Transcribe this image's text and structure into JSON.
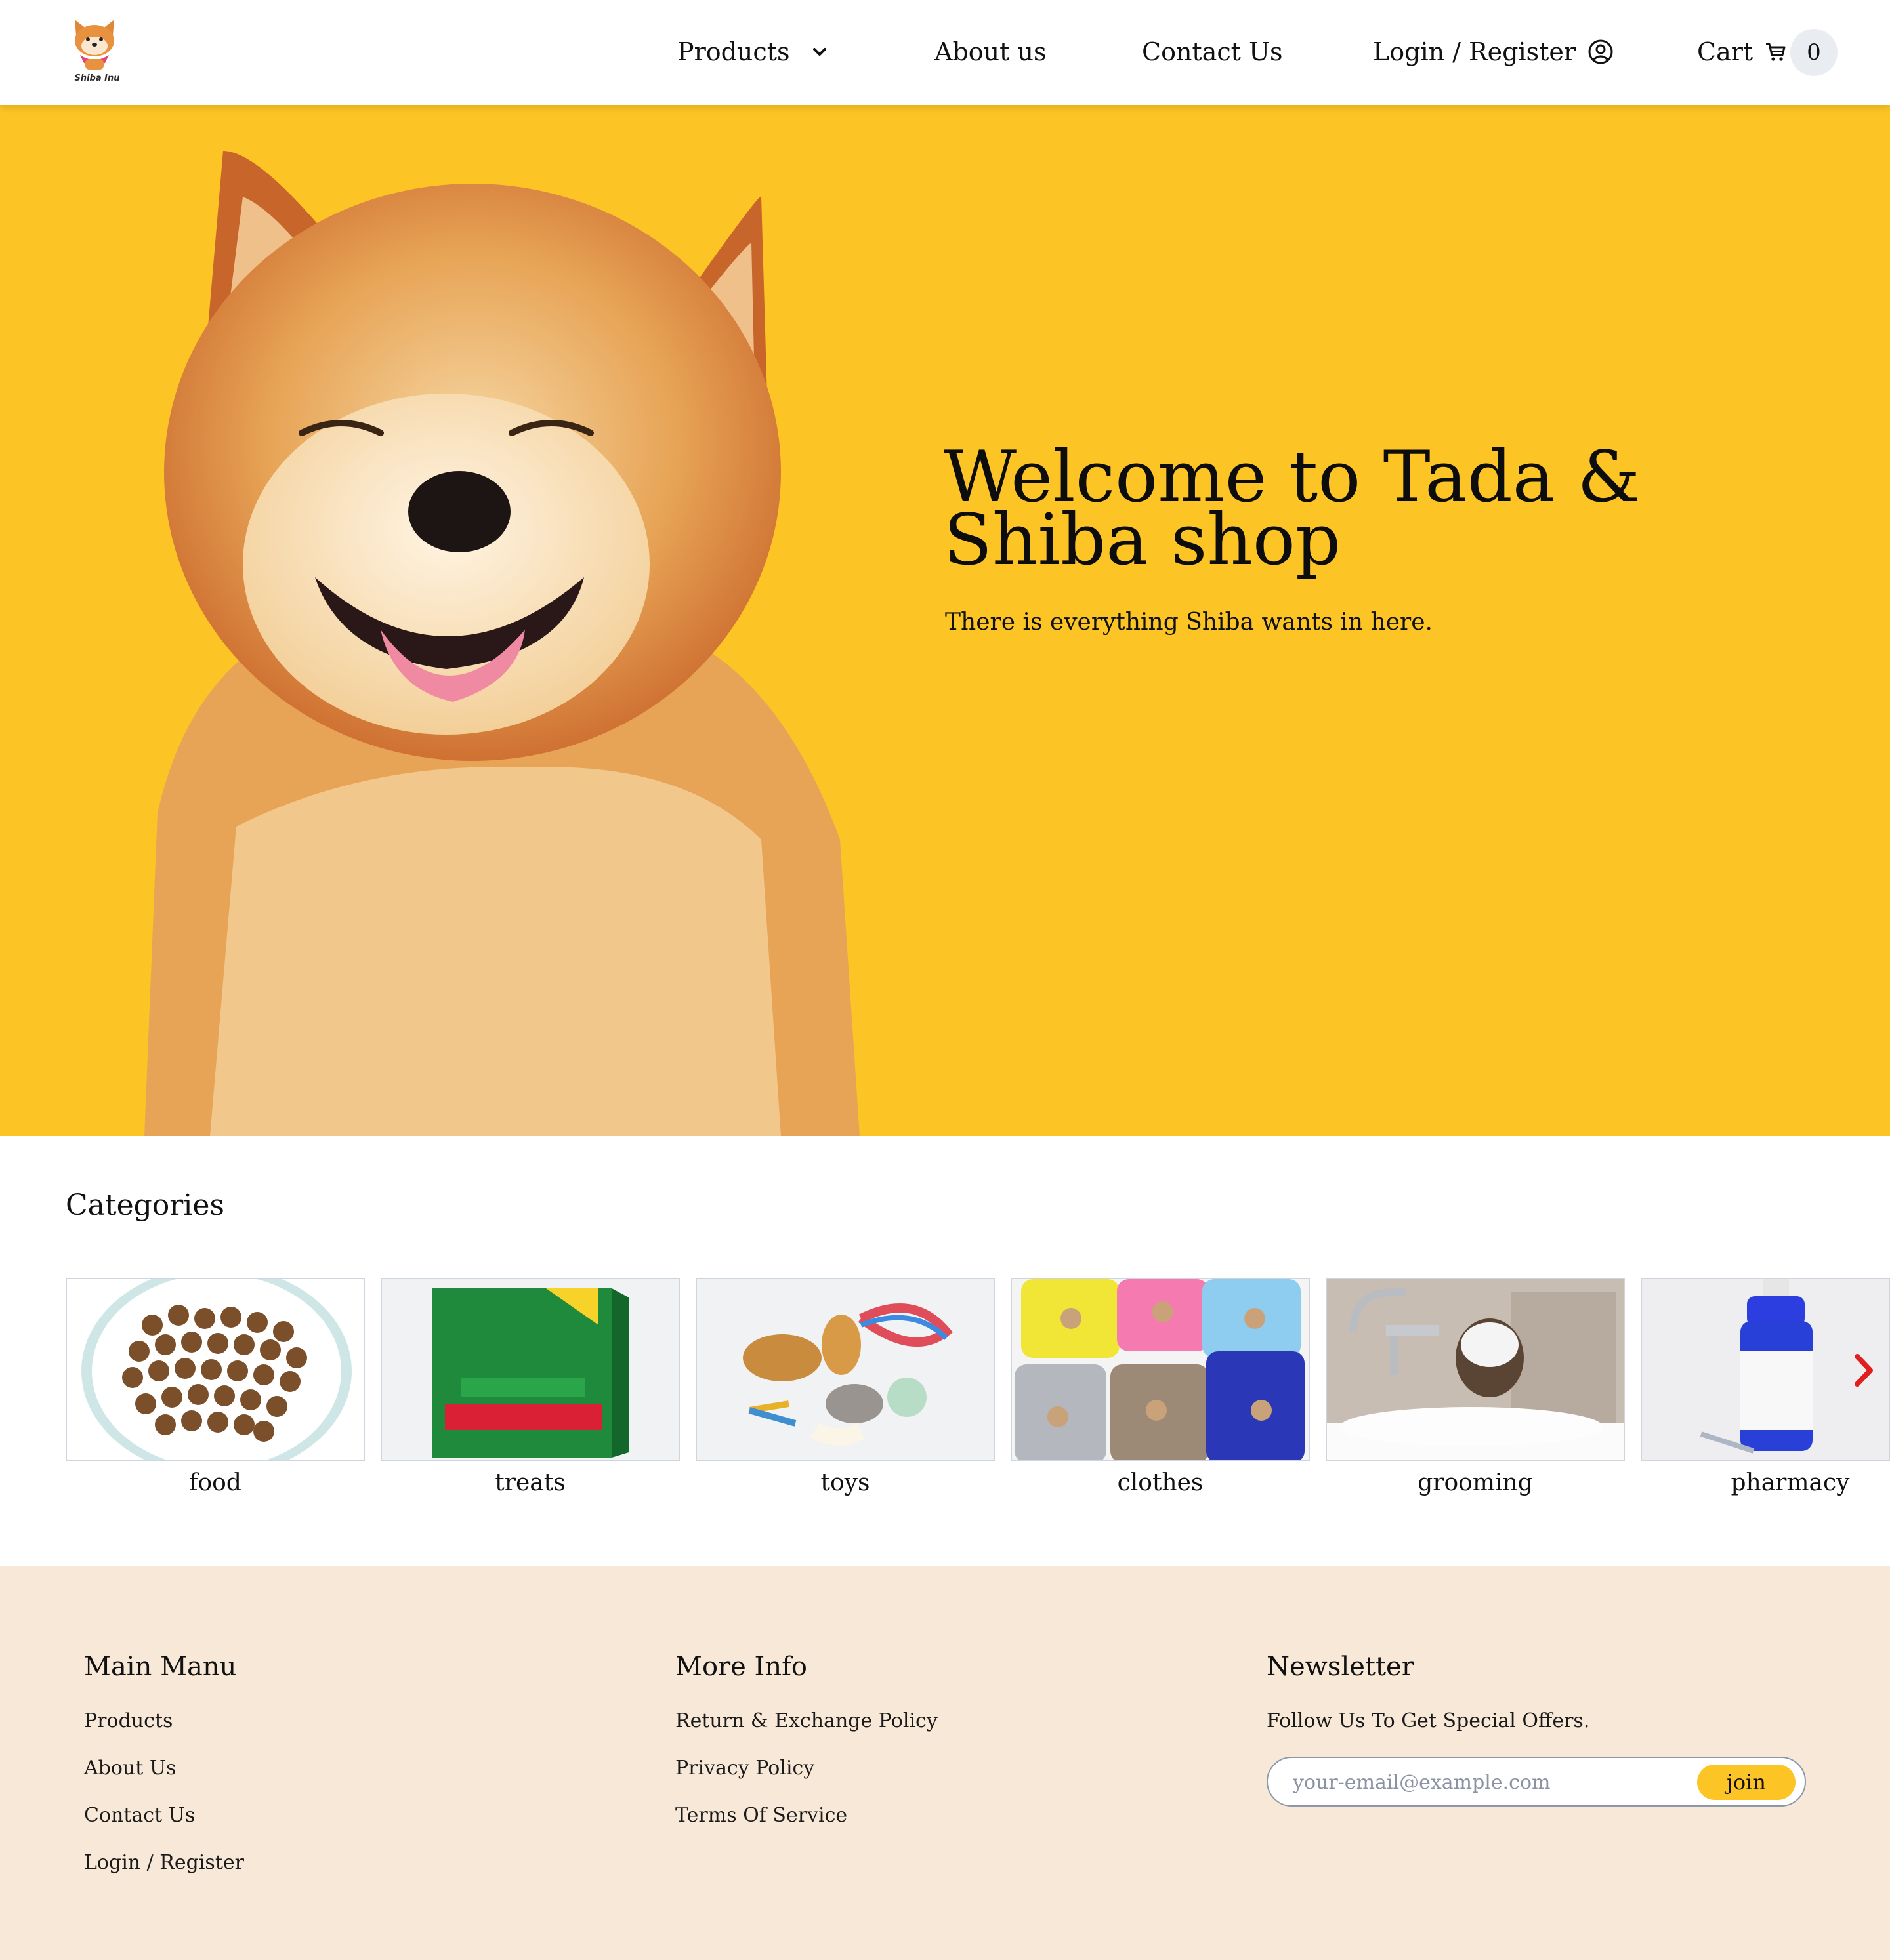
{
  "header": {
    "logo_text": "Shiba Inu",
    "nav": {
      "products": "Products",
      "about": "About us",
      "contact": "Contact Us",
      "login": "Login / Register",
      "cart": "Cart",
      "cart_count": "0"
    }
  },
  "hero": {
    "title": "Welcome to Tada & Shiba shop",
    "subtitle": "There is everything Shiba wants in here."
  },
  "categories": {
    "title": "Categories",
    "items": [
      {
        "label": "food"
      },
      {
        "label": "treats"
      },
      {
        "label": "toys"
      },
      {
        "label": "clothes"
      },
      {
        "label": "grooming"
      },
      {
        "label": "pharmacy"
      }
    ]
  },
  "footer": {
    "main_menu": {
      "title": "Main Manu",
      "links": [
        "Products",
        "About Us",
        "Contact Us",
        "Login / Register"
      ]
    },
    "more_info": {
      "title": "More Info",
      "links": [
        "Return & Exchange Policy",
        "Privacy Policy",
        "Terms Of Service"
      ]
    },
    "newsletter": {
      "title": "Newsletter",
      "text": "Follow Us To Get Special Offers.",
      "placeholder": "your-email@example.com",
      "button": "join"
    }
  },
  "colors": {
    "accent": "#fcc424",
    "footer_bg": "#f8e8d8",
    "arrow": "#e0201f"
  }
}
